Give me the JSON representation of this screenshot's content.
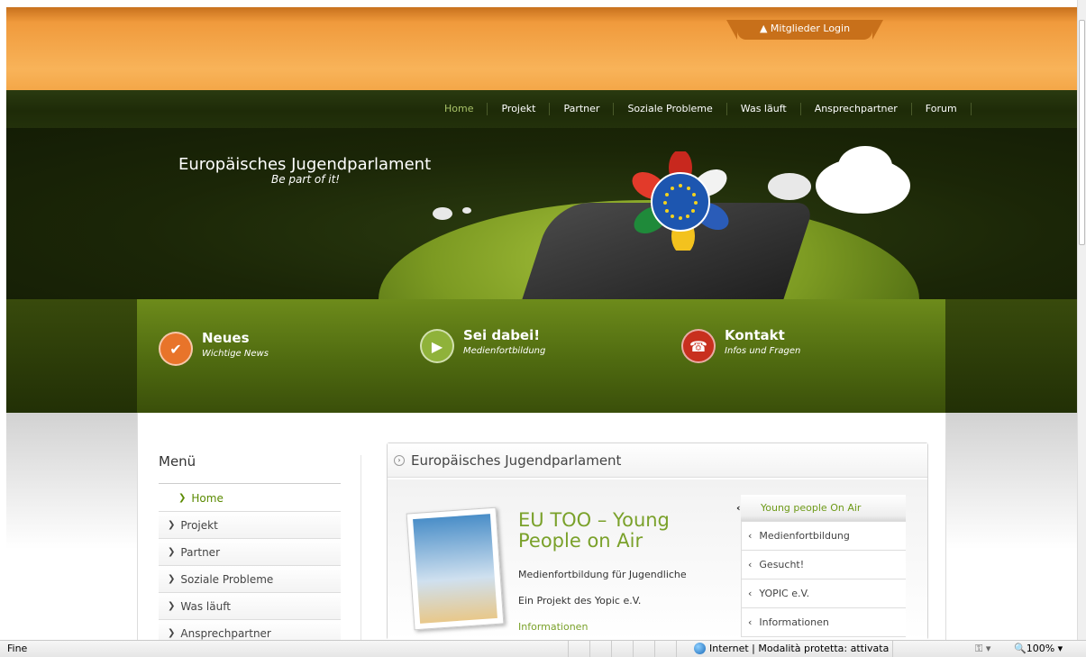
{
  "header": {
    "login_label": "▲ Mitglieder Login"
  },
  "nav": {
    "items": [
      "Home",
      "Projekt",
      "Partner",
      "Soziale Probleme",
      "Was läuft",
      "Ansprechpartner",
      "Forum"
    ],
    "active": "Home"
  },
  "banner": {
    "title": "Europäisches Jugendparlament",
    "slogan": "Be part of it!"
  },
  "features": [
    {
      "title": "Neues",
      "subtitle": "Wichtige News",
      "icon": "check-icon",
      "color": "#e8742a"
    },
    {
      "title": "Sei dabei!",
      "subtitle": "Medienfortbildung",
      "icon": "play-icon",
      "color": "#8fb23a"
    },
    {
      "title": "Kontakt",
      "subtitle": "Infos und Fragen",
      "icon": "contact-icon",
      "color": "#c8301e"
    }
  ],
  "sidebar": {
    "title": "Menü",
    "items": [
      "Home",
      "Projekt",
      "Partner",
      "Soziale Probleme",
      "Was läuft",
      "Ansprechpartner"
    ]
  },
  "panel": {
    "title": "Europäisches Jugendparlament"
  },
  "article": {
    "title": "EU TOO – Young People on Air",
    "line1": "Medienfortbildung für Jugendliche",
    "line2": "Ein Projekt des Yopic e.V.",
    "link": "Informationen"
  },
  "tabs": [
    "Young people On Air",
    "Medienfortbildung",
    "Gesucht!",
    "YOPIC e.V.",
    "Informationen"
  ],
  "status": {
    "left": "Fine",
    "zone": "Internet | Modalità protetta: attivata",
    "zoom": "100%"
  },
  "colors": {
    "accent_green": "#7aa12a",
    "header_orange": "#f8b359",
    "nav_dark": "#1e2b08"
  }
}
